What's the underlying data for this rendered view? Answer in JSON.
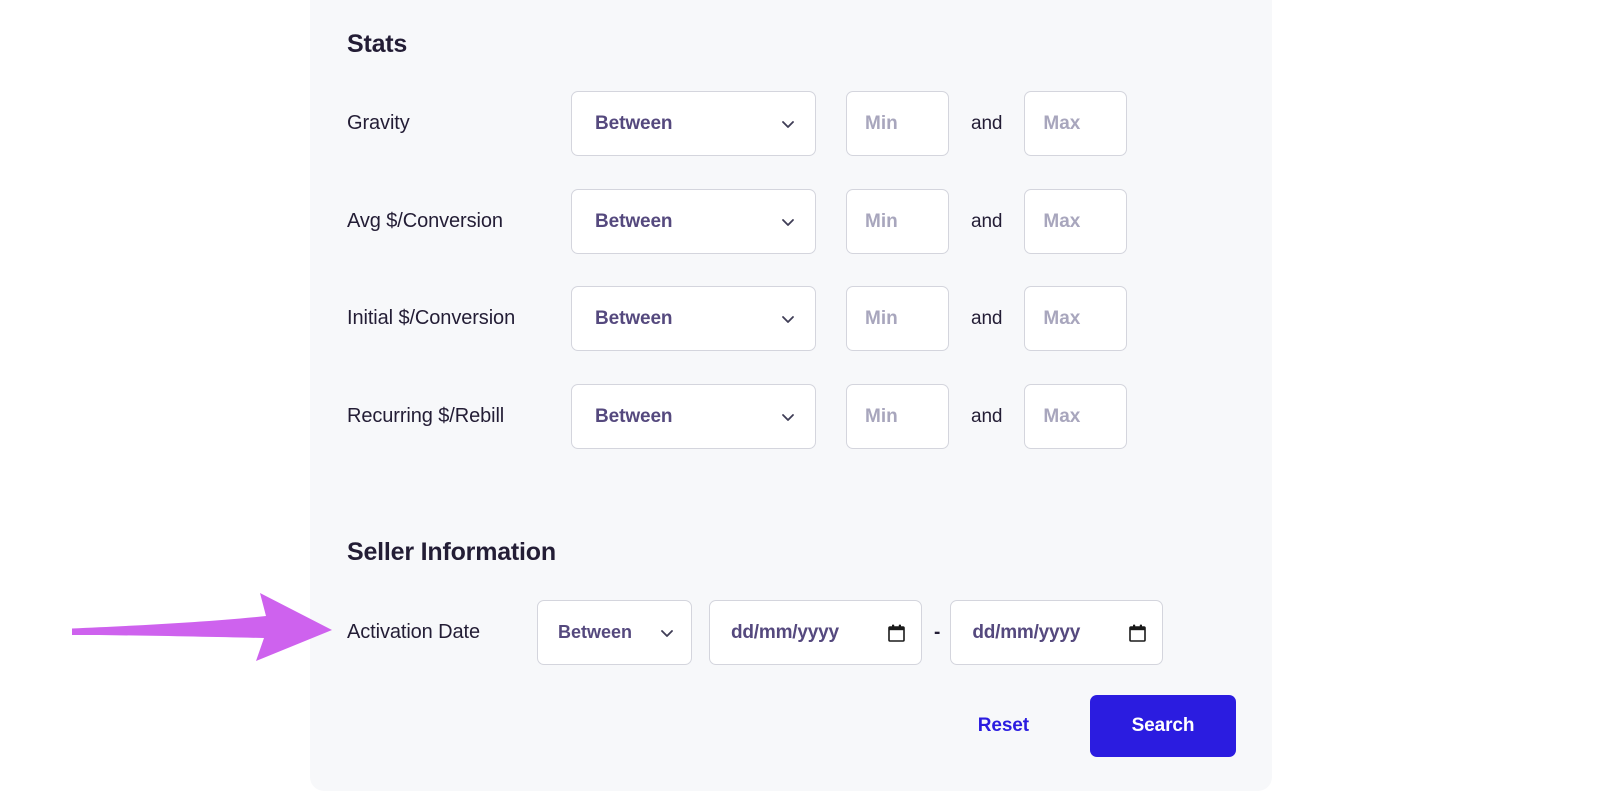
{
  "panel": {
    "background_color": "#F7F8FA"
  },
  "stats": {
    "heading": "Stats",
    "and_label": "and",
    "rows": [
      {
        "label": "Gravity",
        "operator": "Between",
        "min_placeholder": "Min",
        "min_value": "",
        "max_placeholder": "Max",
        "max_value": ""
      },
      {
        "label": "Avg $/Conversion",
        "operator": "Between",
        "min_placeholder": "Min",
        "min_value": "",
        "max_placeholder": "Max",
        "max_value": ""
      },
      {
        "label": "Initial $/Conversion",
        "operator": "Between",
        "min_placeholder": "Min",
        "min_value": "",
        "max_placeholder": "Max",
        "max_value": ""
      },
      {
        "label": "Recurring $/Rebill",
        "operator": "Between",
        "min_placeholder": "Min",
        "min_value": "",
        "max_placeholder": "Max",
        "max_value": ""
      }
    ]
  },
  "seller_information": {
    "heading": "Seller Information",
    "activation_date": {
      "label": "Activation Date",
      "operator": "Between",
      "start_date_placeholder": "dd/mm/yyyy",
      "end_date_placeholder": "dd/mm/yyyy",
      "separator": "-",
      "calendar_icon": "calendar-icon"
    }
  },
  "actions": {
    "reset_label": "Reset",
    "search_label": "Search",
    "primary_color": "#2B1CE0"
  },
  "annotation": {
    "arrow_color": "#CE62EE",
    "points_to": "Activation Date"
  },
  "icons": {
    "chevron_down": "chevron-down-icon"
  }
}
